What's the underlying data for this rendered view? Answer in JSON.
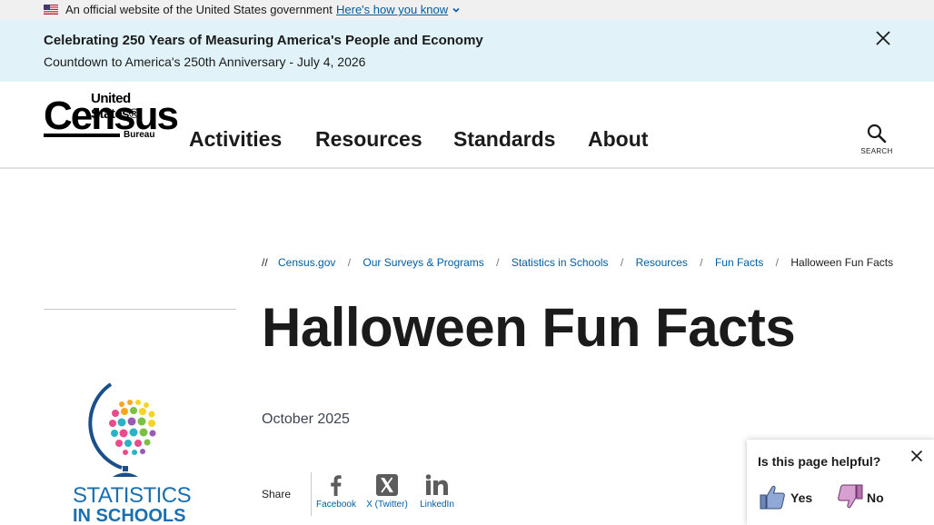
{
  "gov_banner": {
    "text": "An official website of the United States government",
    "link": "Here's how you know"
  },
  "alert": {
    "title": "Celebrating 250 Years of Measuring America's People and Economy",
    "subtitle": "Countdown to America's 250th Anniversary - July 4, 2026"
  },
  "logo": {
    "top": "United States®",
    "main": "Census",
    "bottom": "Bureau"
  },
  "nav": {
    "items": [
      "Activities",
      "Resources",
      "Standards",
      "About"
    ],
    "search_label": "SEARCH"
  },
  "breadcrumb": {
    "prefix": "//",
    "links": [
      "Census.gov",
      "Our Surveys & Programs",
      "Statistics in Schools",
      "Resources",
      "Fun Facts"
    ],
    "current": "Halloween Fun Facts"
  },
  "page": {
    "title": "Halloween Fun Facts",
    "date": "October 2025"
  },
  "sis_logo": {
    "line1": "STATISTICS",
    "line2": "IN SCHOOLS"
  },
  "share": {
    "label": "Share",
    "items": [
      {
        "label": "Facebook",
        "icon": "facebook-icon"
      },
      {
        "label": "X (Twitter)",
        "icon": "x-twitter-icon"
      },
      {
        "label": "LinkedIn",
        "icon": "linkedin-icon"
      }
    ]
  },
  "feedback": {
    "question": "Is this page helpful?",
    "yes": "Yes",
    "no": "No"
  },
  "colors": {
    "link": "#005ea2",
    "alert_bg": "#e1f3f8",
    "gov_banner_bg": "#f0f0f0",
    "sis_blue": "#1a6fb0"
  }
}
